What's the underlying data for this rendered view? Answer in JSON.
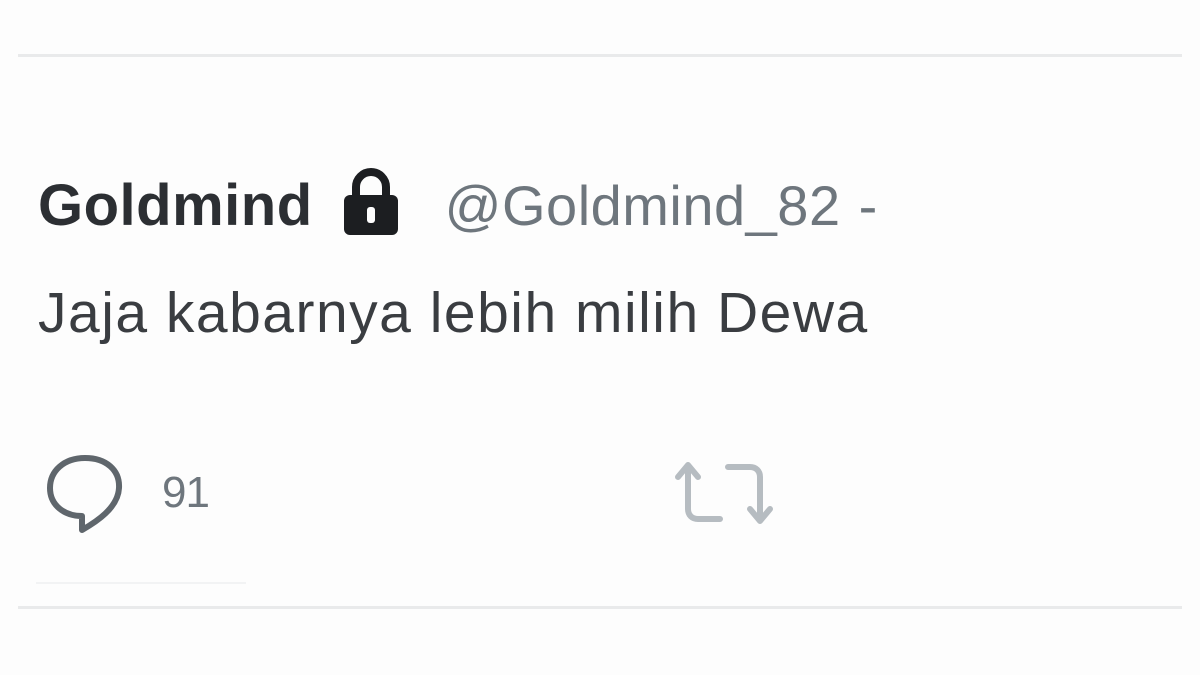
{
  "tweet": {
    "display_name": "Goldmind",
    "protected_icon": "lock-icon",
    "handle": "@Goldmind_82",
    "separator": "-",
    "text": "Jaja kabarnya lebih milih Dewa",
    "actions": {
      "reply": {
        "icon": "reply-icon",
        "count": "91"
      },
      "retweet": {
        "icon": "retweet-icon"
      }
    }
  },
  "colors": {
    "name": "#2c2f33",
    "secondary": "#6e767d",
    "body": "#3a3d41",
    "divider": "#e9eaeb",
    "icon_dark": "#1c1e21",
    "icon_muted": "#6e767d",
    "retweet_icon": "#b6bcc1"
  }
}
